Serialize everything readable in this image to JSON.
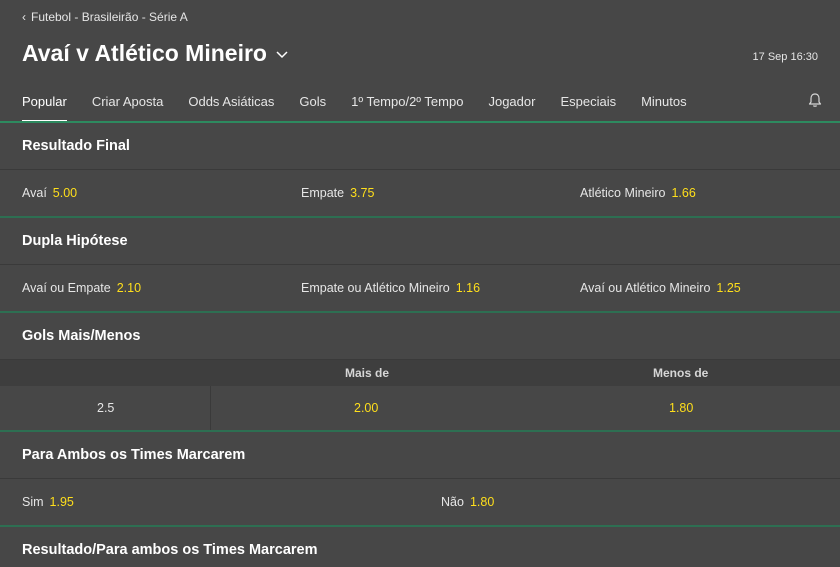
{
  "header": {
    "breadcrumb": "Futebol - Brasileirão - Série A",
    "title": "Avaí v Atlético Mineiro",
    "datetime": "17 Sep 16:30"
  },
  "tabs": [
    {
      "label": "Popular",
      "active": true
    },
    {
      "label": "Criar Aposta"
    },
    {
      "label": "Odds Asiáticas"
    },
    {
      "label": "Gols"
    },
    {
      "label": "1º Tempo/2º Tempo"
    },
    {
      "label": "Jogador"
    },
    {
      "label": "Especiais"
    },
    {
      "label": "Minutos"
    }
  ],
  "markets": {
    "resultado_final": {
      "title": "Resultado Final",
      "options": [
        {
          "label": "Avaí",
          "odd": "5.00"
        },
        {
          "label": "Empate",
          "odd": "3.75"
        },
        {
          "label": "Atlético Mineiro",
          "odd": "1.66"
        }
      ]
    },
    "dupla_hipotese": {
      "title": "Dupla Hipótese",
      "options": [
        {
          "label": "Avaí ou Empate",
          "odd": "2.10"
        },
        {
          "label": "Empate ou Atlético Mineiro",
          "odd": "1.16"
        },
        {
          "label": "Avaí ou Atlético Mineiro",
          "odd": "1.25"
        }
      ]
    },
    "gols_mais_menos": {
      "title": "Gols Mais/Menos",
      "col_over": "Mais de",
      "col_under": "Menos de",
      "line": "2.5",
      "over_odd": "2.00",
      "under_odd": "1.80"
    },
    "ambos_marcam": {
      "title": "Para Ambos os Times Marcarem",
      "options": [
        {
          "label": "Sim",
          "odd": "1.95"
        },
        {
          "label": "Não",
          "odd": "1.80"
        }
      ]
    },
    "resultado_ambos": {
      "title": "Resultado/Para ambos os Times Marcarem"
    }
  },
  "colors": {
    "background": "#474747",
    "odd": "#ffdf1b",
    "accent_line": "#2d8a5f"
  },
  "icons": [
    "chevron-left-icon",
    "chevron-down-icon",
    "bell-icon"
  ]
}
